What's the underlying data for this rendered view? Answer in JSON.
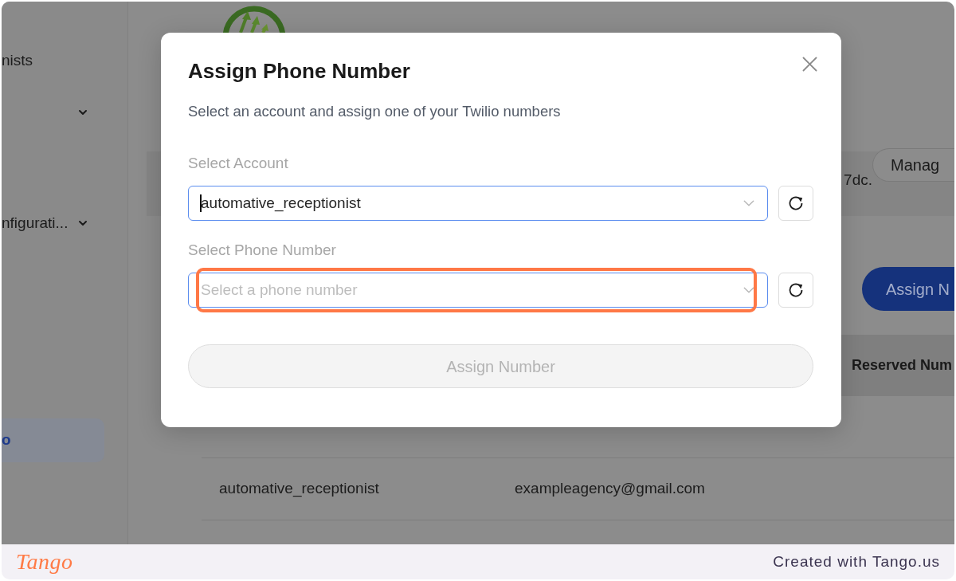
{
  "sidebar": {
    "items": [
      {
        "kind": "link",
        "label": "nists",
        "selected": false
      },
      {
        "kind": "group",
        "expanded": false,
        "selected": false
      },
      {
        "kind": "group",
        "label": "nfigurati...",
        "expanded": false,
        "selected": false
      },
      {
        "kind": "link",
        "label": "o",
        "selected": true
      }
    ]
  },
  "main": {
    "banner": {
      "text": "7dc.",
      "button": "Manag"
    },
    "assign_button": "Assign N",
    "table": {
      "column_3": "Reserved Num",
      "rows": [
        {
          "column_1": "automative_receptionist",
          "column_2": "exampleagency@gmail.com"
        }
      ]
    }
  },
  "dialog": {
    "title": "Assign Phone Number",
    "subtitle": "Select an account and assign one of your Twilio numbers",
    "fields": [
      {
        "label": "Select Account",
        "value": "automative_receptionist",
        "focused": true,
        "highlighted": false
      },
      {
        "label": "Select Phone Number",
        "placeholder": "Select a phone number",
        "focused": false,
        "highlighted": true
      }
    ],
    "submit": {
      "label": "Assign Number",
      "disabled": true
    }
  },
  "footer": {
    "logo": "Tango",
    "credit": "Created with Tango.us"
  }
}
